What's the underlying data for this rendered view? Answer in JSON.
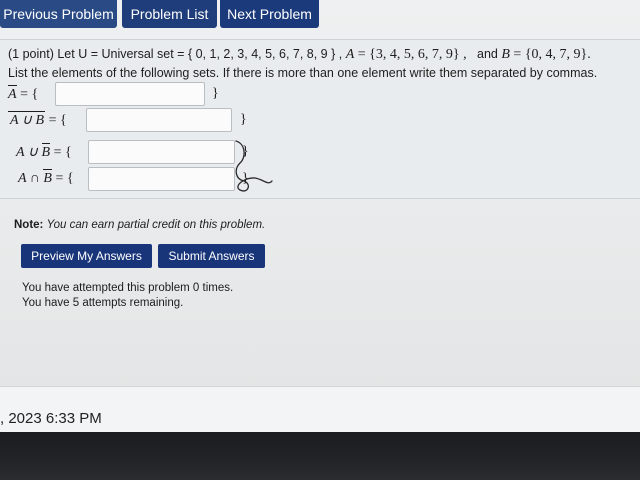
{
  "nav": {
    "prev_label": "Previous Problem",
    "list_label": "Problem List",
    "next_label": "Next Problem"
  },
  "problem": {
    "points": "(1 point)",
    "intro": "Let U = Universal set = { 0, 1, 2, 3, 4, 5, 6, 7, 8, 9 } ,",
    "set_a_name": "A",
    "set_a_value": "= {3, 4, 5, 6, 7, 9} ,",
    "and_text": "and",
    "set_b_name": "B",
    "set_b_value": "= {0, 4, 7, 9}.",
    "instructions": "List the elements of the following sets. If there is more than one element write them separated by commas.",
    "rows": [
      {
        "label_parts": [
          "A",
          "= {"
        ],
        "answer": "",
        "close": "}"
      },
      {
        "label_parts": [
          "A ∪ B",
          "= {"
        ],
        "answer": "",
        "close": "}"
      },
      {
        "label_parts": [
          "A ∪",
          "B",
          "= {"
        ],
        "answer": "",
        "close": "}"
      },
      {
        "label_parts": [
          "A ∩",
          "B",
          "= {"
        ],
        "answer": "",
        "close": "}"
      }
    ]
  },
  "note": {
    "label": "Note:",
    "text": "You can earn partial credit on this problem."
  },
  "actions": {
    "preview_label": "Preview My Answers",
    "submit_label": "Submit Answers"
  },
  "status": {
    "attempted": "You have attempted this problem 0 times.",
    "remaining": "You have 5 attempts remaining."
  },
  "footer": {
    "timestamp": ", 2023 6:33 PM"
  }
}
